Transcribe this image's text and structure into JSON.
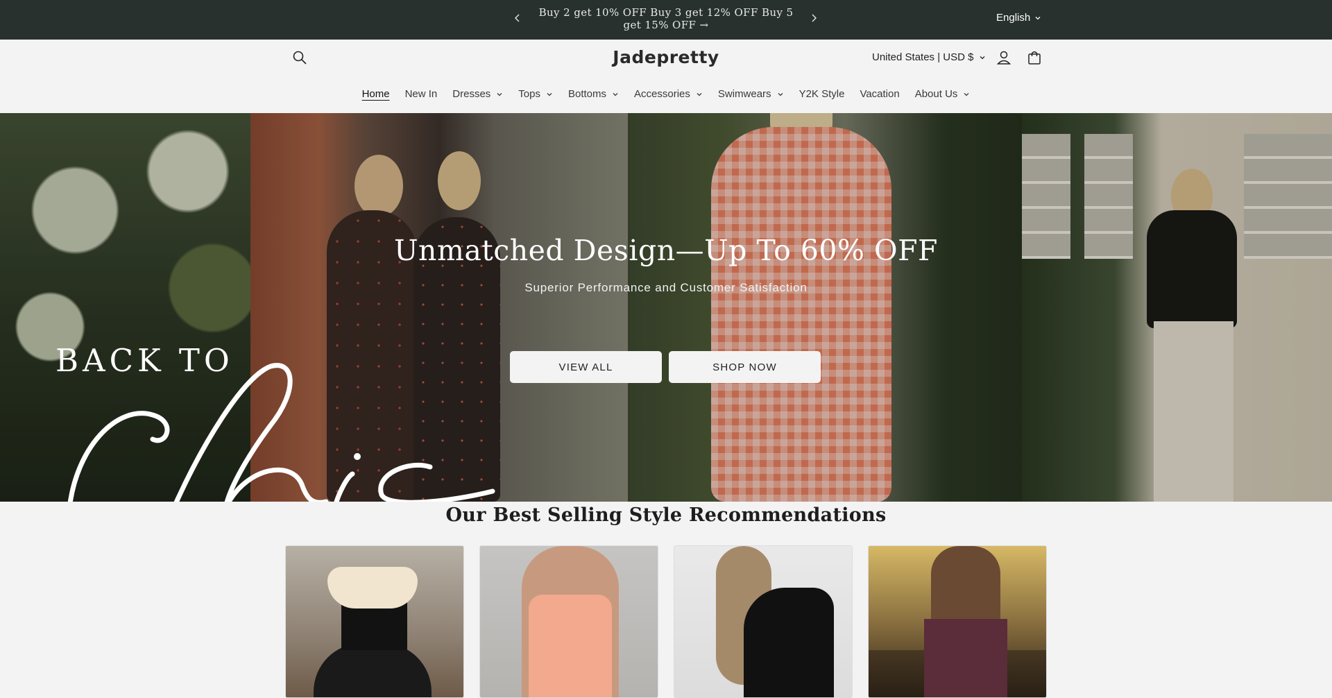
{
  "announcement": {
    "message": "Buy 2 get 10% OFF   Buy 3 get 12% OFF   Buy 5 get 15% OFF",
    "arrow": "→",
    "prev_icon": "chevron-left-icon",
    "next_icon": "chevron-right-icon",
    "language": "English"
  },
  "header": {
    "logo": "Jadepretty",
    "currency": "United States | USD $",
    "icons": [
      "search-icon",
      "account-icon",
      "cart-icon"
    ]
  },
  "nav": {
    "items": [
      {
        "label": "Home",
        "active": true,
        "dropdown": false
      },
      {
        "label": "New In",
        "dropdown": false
      },
      {
        "label": "Dresses",
        "dropdown": true
      },
      {
        "label": "Tops",
        "dropdown": true
      },
      {
        "label": "Bottoms",
        "dropdown": true
      },
      {
        "label": "Accessories",
        "dropdown": true
      },
      {
        "label": "Swimwears",
        "dropdown": true
      },
      {
        "label": "Y2K Style",
        "dropdown": false
      },
      {
        "label": "Vacation",
        "dropdown": false
      },
      {
        "label": "About Us",
        "dropdown": true
      }
    ]
  },
  "hero": {
    "side_text_top": "BACK TO",
    "side_text_script": "chic",
    "title": "Unmatched Design—Up To 60% OFF",
    "subtitle": "Superior Performance and Customer Satisfaction",
    "buttons": [
      "VIEW ALL",
      "SHOP NOW"
    ]
  },
  "recommendations": {
    "title": "Our Best Selling Style Recommendations"
  },
  "colors": {
    "announcement_bg": "#28312e",
    "page_bg": "#f3f3f3",
    "button_bg": "#f3f3f3"
  }
}
